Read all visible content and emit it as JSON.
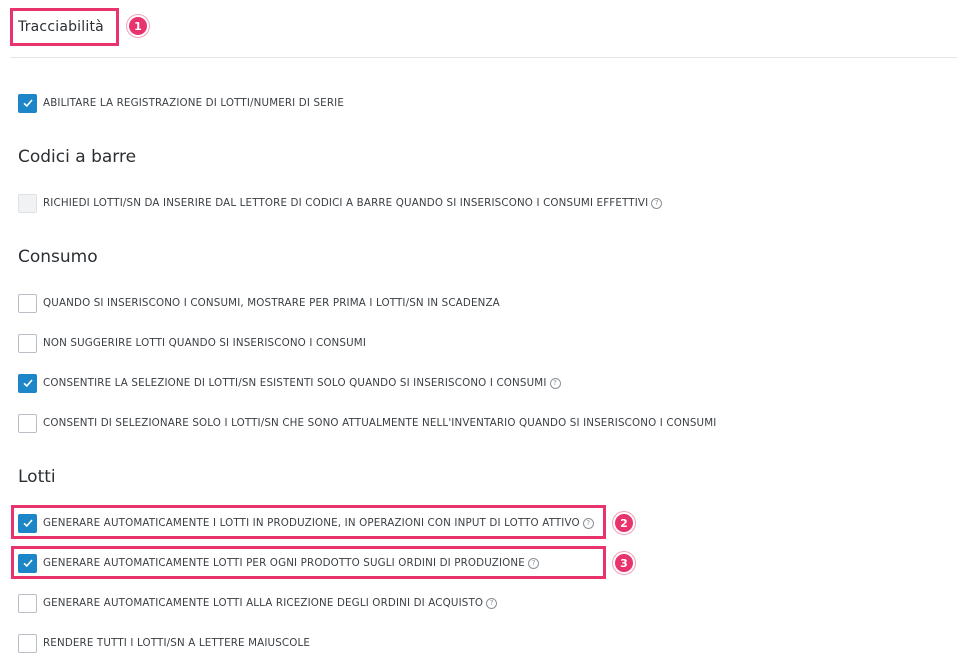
{
  "tab": {
    "title": "Tracciabilità"
  },
  "badges": {
    "b1": "1",
    "b2": "2",
    "b3": "3"
  },
  "top_option": {
    "label": "ABILITARE LA REGISTRAZIONE DI LOTTI/NUMERI DI SERIE",
    "checked": true
  },
  "sections": {
    "barcode": {
      "title": "Codici a barre",
      "options": [
        {
          "label": "RICHIEDI LOTTI/SN DA INSERIRE DAL LETTORE DI CODICI A BARRE QUANDO SI INSERISCONO I CONSUMI EFFETTIVI",
          "checked": false,
          "disabled": true,
          "help": true
        }
      ]
    },
    "consumption": {
      "title": "Consumo",
      "options": [
        {
          "label": "QUANDO SI INSERISCONO I CONSUMI, MOSTRARE PER PRIMA I LOTTI/SN IN SCADENZA",
          "checked": false
        },
        {
          "label": "NON SUGGERIRE LOTTI QUANDO SI INSERISCONO I CONSUMI",
          "checked": false
        },
        {
          "label": "CONSENTIRE LA SELEZIONE DI LOTTI/SN ESISTENTI SOLO QUANDO SI INSERISCONO I CONSUMI",
          "checked": true,
          "help": true
        },
        {
          "label": "CONSENTI DI SELEZIONARE SOLO I LOTTI/SN CHE SONO ATTUALMENTE NELL'INVENTARIO QUANDO SI INSERISCONO I CONSUMI",
          "checked": false
        }
      ]
    },
    "lots": {
      "title": "Lotti",
      "options": [
        {
          "label": "GENERARE AUTOMATICAMENTE I LOTTI IN PRODUZIONE, IN OPERAZIONI CON INPUT DI LOTTO ATTIVO",
          "checked": true,
          "help": true
        },
        {
          "label": "GENERARE AUTOMATICAMENTE LOTTI PER OGNI PRODOTTO SUGLI ORDINI DI PRODUZIONE",
          "checked": true,
          "help": true
        },
        {
          "label": "GENERARE AUTOMATICAMENTE LOTTI ALLA RICEZIONE DEGLI ORDINI DI ACQUISTO",
          "checked": false,
          "help": true
        },
        {
          "label": "RENDERE TUTTI I LOTTI/SN A LETTERE MAIUSCOLE",
          "checked": false
        }
      ]
    }
  },
  "help_glyph": "?",
  "colors": {
    "accent": "#1d86c8",
    "highlight": "#e8336d"
  }
}
